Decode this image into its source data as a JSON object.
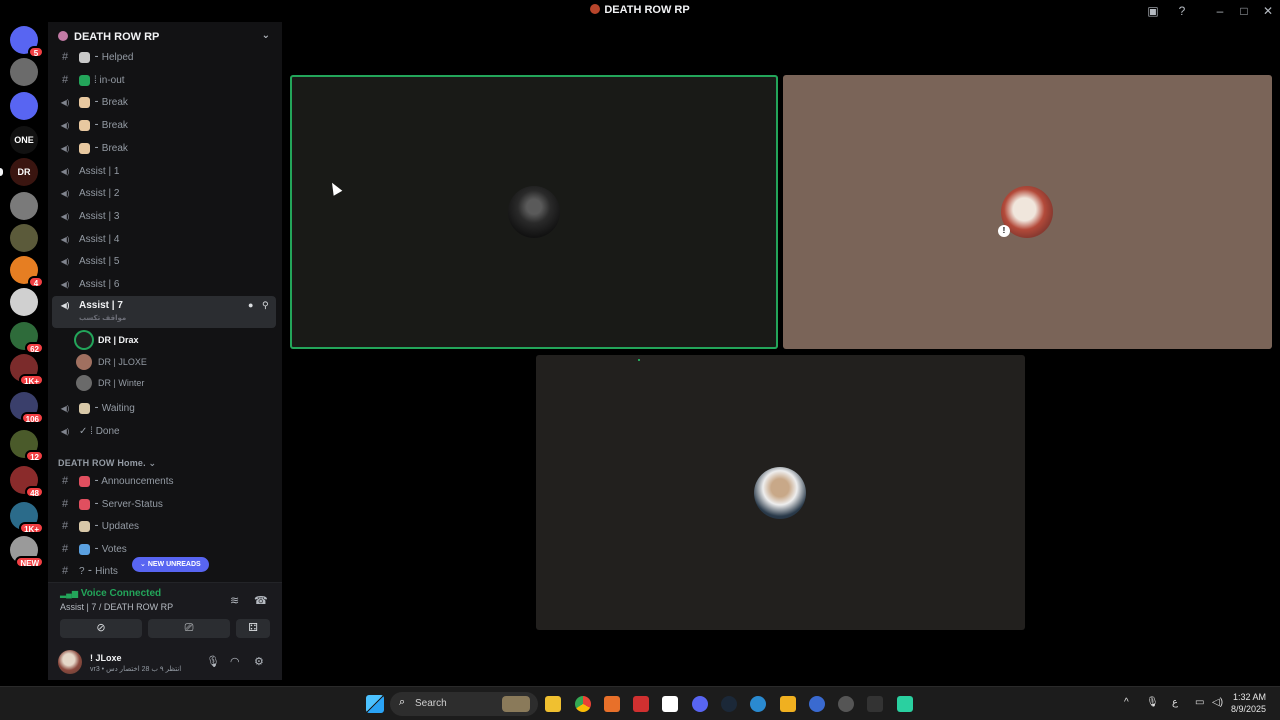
{
  "window": {
    "title": "DEATH ROW RP"
  },
  "server_rail": {
    "servers": [
      {
        "name": "discord-home",
        "badge": "5",
        "color": "#5865f2"
      },
      {
        "name": "server-1",
        "badge": "",
        "color": "#6b6b6b"
      },
      {
        "name": "folder",
        "badge": "",
        "color": "#5865f2"
      },
      {
        "name": "one",
        "badge": "",
        "label": "ONE",
        "color": "#111"
      },
      {
        "name": "death-row",
        "badge": "",
        "label": "DR",
        "color": "#3a1510"
      },
      {
        "name": "server-6",
        "badge": "",
        "color": "#7a7a7a"
      },
      {
        "name": "server-7",
        "badge": "",
        "color": "#5b5a3a"
      },
      {
        "name": "server-8",
        "badge": "4",
        "color": "#e67e22"
      },
      {
        "name": "server-9",
        "badge": "",
        "color": "#d0d0d0"
      },
      {
        "name": "server-10",
        "badge": "62",
        "color": "#2e6b3a"
      },
      {
        "name": "server-11",
        "badge": "1K+",
        "color": "#7b2b2b"
      },
      {
        "name": "server-12",
        "badge": "106",
        "color": "#3a3f6b"
      },
      {
        "name": "server-13",
        "badge": "12",
        "color": "#4a5a2a"
      },
      {
        "name": "server-14",
        "badge": "48",
        "color": "#8a2b2b"
      },
      {
        "name": "server-15",
        "badge": "1K+",
        "color": "#2b6b8a"
      },
      {
        "name": "server-16",
        "badge": "NEW",
        "color": "#9a9a9a"
      }
    ]
  },
  "sidebar": {
    "guild_name": "DEATH ROW RP",
    "channels_top": [
      {
        "type": "text",
        "emoji_color": "#c9c9c9",
        "label": "⁃ Helped"
      },
      {
        "type": "text",
        "emoji_color": "#23a55a",
        "label": "⁞ in-out"
      },
      {
        "type": "voice",
        "emoji_color": "#e8c8a0",
        "label": "⁃ Break"
      },
      {
        "type": "voice",
        "emoji_color": "#e8c8a0",
        "label": "⁃ Break"
      },
      {
        "type": "voice",
        "emoji_color": "#e8c8a0",
        "label": "⁃ Break"
      },
      {
        "type": "voice",
        "emoji_color": "",
        "label": "Assist | 1"
      },
      {
        "type": "voice",
        "emoji_color": "",
        "label": "Assist | 2"
      },
      {
        "type": "voice",
        "emoji_color": "",
        "label": "Assist | 3"
      },
      {
        "type": "voice",
        "emoji_color": "",
        "label": "Assist | 4"
      },
      {
        "type": "voice",
        "emoji_color": "",
        "label": "Assist | 5"
      },
      {
        "type": "voice",
        "emoji_color": "",
        "label": "Assist | 6"
      }
    ],
    "active_channel": {
      "label": "Assist | 7",
      "subtitle": "مواقف تكسب"
    },
    "voice_users": [
      {
        "name": "DR | Drax",
        "speaking": true,
        "avatar_color": "#1e1e1e"
      },
      {
        "name": "DR | JLOXE",
        "speaking": false,
        "avatar_color": "#a07060"
      },
      {
        "name": "DR | Winter",
        "speaking": false,
        "avatar_color": "#6a6a6a"
      }
    ],
    "channels_after": [
      {
        "type": "voice",
        "emoji_color": "#d8c8a8",
        "label": "⁃ Waiting"
      },
      {
        "type": "voice",
        "emoji_color": "",
        "label": "✓ ⁞  Done"
      }
    ],
    "category2": "DEATH ROW Home.",
    "channels_home": [
      {
        "type": "text",
        "emoji_color": "#e04f5f",
        "label": "⁃ Announcements"
      },
      {
        "type": "text",
        "emoji_color": "#e04f5f",
        "label": "⁃ Server-Status"
      },
      {
        "type": "text",
        "emoji_color": "#d8c8a8",
        "label": "⁃ Updates"
      },
      {
        "type": "text",
        "emoji_color": "#5aa0e0",
        "label": "⁃ Votes"
      },
      {
        "type": "text",
        "emoji_color": "",
        "label": "? ⁃ Hints"
      }
    ],
    "new_unreads": "NEW UNREADS"
  },
  "voice_panel": {
    "status": "Voice Connected",
    "location": "Assist | 7 / DEATH ROW RP"
  },
  "user_panel": {
    "name": "! JLoxe",
    "status": "vr3 • انتظر ٩ ب 28 اختصار دس"
  },
  "stage": {
    "tiles": [
      {
        "name": "tile-drax",
        "bg": "#191a17",
        "speaking": true
      },
      {
        "name": "tile-jloxe",
        "bg": "#7a6458",
        "speaking": false
      },
      {
        "name": "tile-winter",
        "bg": "#22201e",
        "speaking": false
      }
    ]
  },
  "taskbar": {
    "search_placeholder": "Search",
    "time": "1:32 AM",
    "date": "8/9/2025",
    "lang": "ع"
  }
}
